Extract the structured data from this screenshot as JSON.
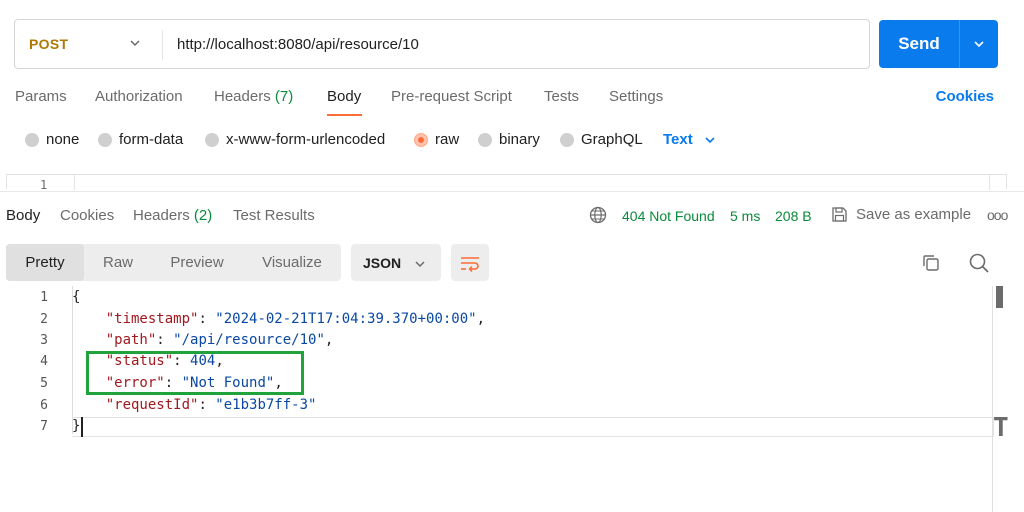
{
  "request": {
    "method": "POST",
    "url": "http://localhost:8080/api/resource/10",
    "send_label": "Send"
  },
  "request_tabs": {
    "params": "Params",
    "authorization": "Authorization",
    "headers": "Headers",
    "headers_count": "(7)",
    "body": "Body",
    "pre_request": "Pre-request Script",
    "tests": "Tests",
    "settings": "Settings",
    "cookies": "Cookies"
  },
  "body_types": {
    "none": "none",
    "form_data": "form-data",
    "urlencoded": "x-www-form-urlencoded",
    "raw": "raw",
    "binary": "binary",
    "graphql": "GraphQL",
    "selected": "raw",
    "raw_format": "Text"
  },
  "request_editor": {
    "line": "1"
  },
  "response_tabs": {
    "body": "Body",
    "cookies": "Cookies",
    "headers": "Headers",
    "headers_count": "(2)",
    "test_results": "Test Results"
  },
  "response_meta": {
    "status": "404 Not Found",
    "time": "5 ms",
    "size": "208 B",
    "save_example": "Save as example",
    "more": "ooo"
  },
  "view_modes": {
    "pretty": "Pretty",
    "raw": "Raw",
    "preview": "Preview",
    "visualize": "Visualize",
    "active": "Pretty",
    "format": "JSON"
  },
  "response_body": {
    "line_numbers": [
      "1",
      "2",
      "3",
      "4",
      "5",
      "6",
      "7"
    ],
    "open_brace": "{",
    "close_brace": "}",
    "lines": [
      {
        "key": "\"timestamp\"",
        "value": "\"2024-02-21T17:04:39.370+00:00\"",
        "trail": ","
      },
      {
        "key": "\"path\"",
        "value": "\"/api/resource/10\"",
        "trail": ","
      },
      {
        "key": "\"status\"",
        "value": "404",
        "trail": ","
      },
      {
        "key": "\"error\"",
        "value": "\"Not Found\"",
        "trail": ","
      },
      {
        "key": "\"requestId\"",
        "value": "\"e1b3b7ff-3\"",
        "trail": ""
      }
    ]
  },
  "colors": {
    "accent": "#097bed",
    "method": "#ad7a03",
    "status_ok_text": "#0a8a3a",
    "active_tab": "#ff6c37",
    "highlight_box": "#21a33b",
    "json_key": "#a1191e",
    "json_value": "#0a48a3"
  },
  "icons": {
    "method_dropdown": "chevron-down-icon",
    "send_dropdown": "chevron-down-icon",
    "network": "globe-icon",
    "save": "save-icon",
    "wrap": "wrap-lines-icon",
    "copy": "copy-icon",
    "search": "search-icon"
  }
}
